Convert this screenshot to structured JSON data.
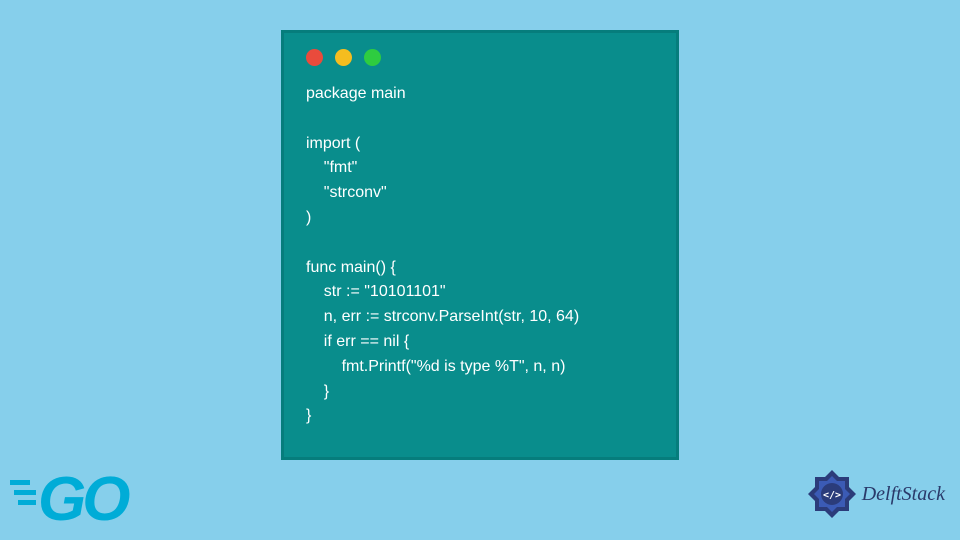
{
  "code": {
    "lines": [
      "package main",
      "",
      "import (",
      "    \"fmt\"",
      "    \"strconv\"",
      ")",
      "",
      "func main() {",
      "    str := \"10101101\"",
      "    n, err := strconv.ParseInt(str, 10, 64)",
      "    if err == nil {",
      "        fmt.Printf(\"%d is type %T\", n, n)",
      "    }",
      "}"
    ]
  },
  "branding": {
    "go_logo_text": "GO",
    "delft_text": "DelftStack"
  },
  "colors": {
    "background": "#86cfeb",
    "window": "#098d8c",
    "window_border": "#067d7c",
    "code_text": "#ffffff",
    "go_blue": "#00acd7",
    "delft_blue": "#2a3a6a"
  }
}
